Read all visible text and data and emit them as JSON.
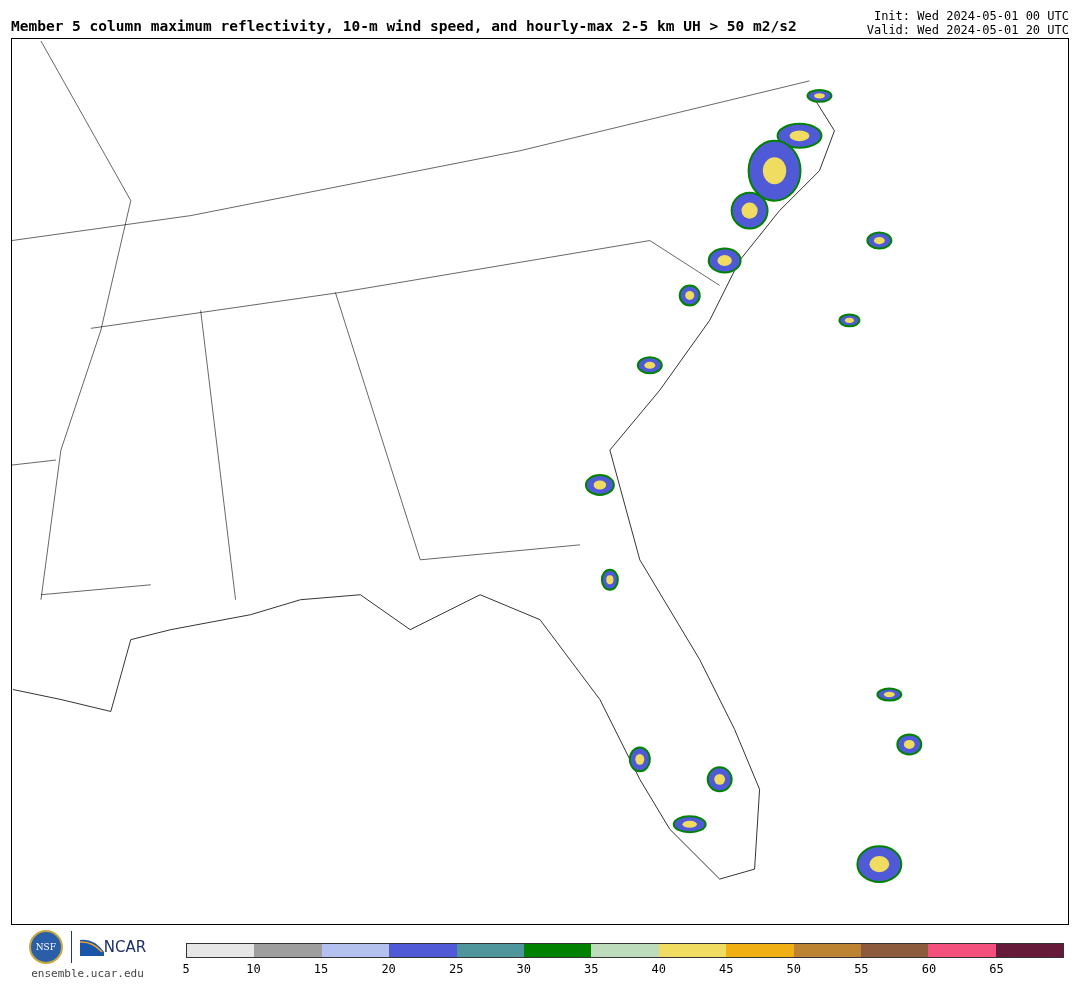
{
  "header": {
    "title": "Member 5 column maximum reflectivity, 10-m wind speed, and hourly-max 2-5 km UH > 50 m2/s2",
    "init": "Init: Wed 2024-05-01 00 UTC",
    "valid": "Valid: Wed 2024-05-01 20 UTC"
  },
  "footer": {
    "nsf_logo": "NSF",
    "ncar_logo": "NCAR",
    "site": "ensemble.ucar.edu"
  },
  "colorbar": {
    "segments": [
      {
        "color": "#e6e6e6"
      },
      {
        "color": "#9e9e9e"
      },
      {
        "color": "#b4c0ee"
      },
      {
        "color": "#505ad6"
      },
      {
        "color": "#4e969c"
      },
      {
        "color": "#008200"
      },
      {
        "color": "#bcdcbc"
      },
      {
        "color": "#f0dc60"
      },
      {
        "color": "#f0b014"
      },
      {
        "color": "#bc8432"
      },
      {
        "color": "#8c5a3c"
      },
      {
        "color": "#f4507e"
      },
      {
        "color": "#641a38"
      }
    ],
    "ticks": [
      "5",
      "10",
      "15",
      "20",
      "25",
      "30",
      "35",
      "40",
      "45",
      "50",
      "55",
      "60",
      "65"
    ]
  }
}
